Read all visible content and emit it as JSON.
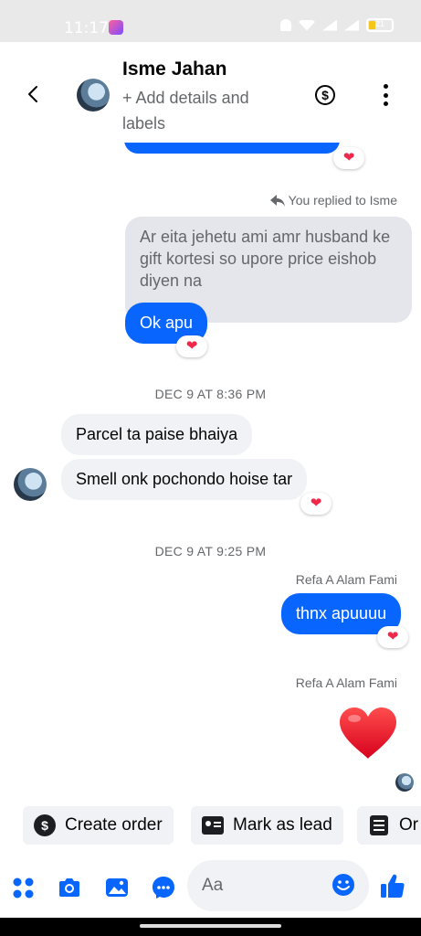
{
  "status_bar": {
    "time": "11:17",
    "battery": "21"
  },
  "header": {
    "contact_name": "Isme Jahan",
    "subtitle": "+ Add details and labels",
    "dollar_symbol": "$"
  },
  "chat": {
    "reaction": "❤",
    "reply_note": "You replied to Isme",
    "quoted_text": "Ar eita jehetu ami amr husband ke gift kortesi so upore price eishob diyen na",
    "reply_bubble": "Ok apu",
    "separator_1": "DEC 9 AT 8:36 PM",
    "incoming_1": "Parcel ta paise bhaiya",
    "incoming_2": "Smell onk pochondo hoise tar",
    "separator_2": "DEC 9 AT 9:25 PM",
    "sender_1": "Refa A Alam Fami",
    "outgoing_1": "thnx apuuuu",
    "sender_2": "Refa A Alam Fami"
  },
  "quick_actions": [
    {
      "label": "Create order",
      "icon": "dollar-circle-icon"
    },
    {
      "label": "Mark as lead",
      "icon": "contact-card-icon"
    },
    {
      "label": "Or",
      "icon": "order-list-icon"
    }
  ],
  "composer": {
    "placeholder": "Aa"
  },
  "colors": {
    "outgoing_bubble": "#0866ff",
    "incoming_bubble": "#f0f2f5",
    "quoted_bubble": "#e4e6eb",
    "accent": "#0866ff",
    "heart": "#f02849"
  }
}
